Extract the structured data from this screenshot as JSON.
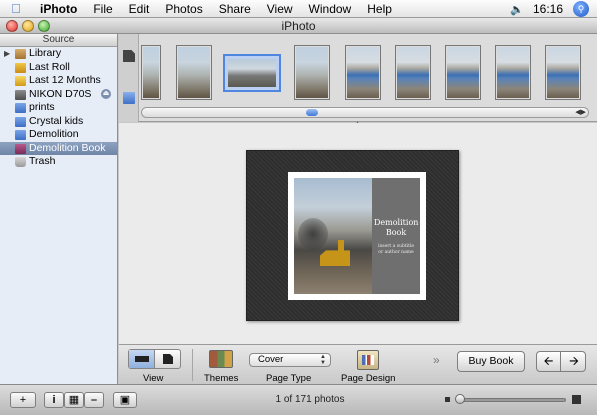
{
  "menubar": {
    "app": "iPhoto",
    "items": [
      "File",
      "Edit",
      "Photos",
      "Share",
      "View",
      "Window",
      "Help"
    ],
    "clock": "16:16"
  },
  "window": {
    "title": "iPhoto"
  },
  "sidebar": {
    "header": "Source",
    "items": [
      {
        "label": "Library",
        "icon": "library-icon"
      },
      {
        "label": "Last Roll",
        "icon": "film-roll-icon"
      },
      {
        "label": "Last 12 Months",
        "icon": "calendar-icon"
      },
      {
        "label": "NIKON D70S",
        "icon": "camera-icon"
      },
      {
        "label": "prints",
        "icon": "album-icon"
      },
      {
        "label": "Crystal kids",
        "icon": "album-icon"
      },
      {
        "label": "Demolition",
        "icon": "album-icon"
      },
      {
        "label": "Demolition Book",
        "icon": "book-icon",
        "selected": true
      },
      {
        "label": "Trash",
        "icon": "trash-icon"
      }
    ]
  },
  "book": {
    "title": "Demolition Book",
    "subtitle": "insert a subtitle or author name"
  },
  "booktools": {
    "view_label": "View",
    "themes_label": "Themes",
    "page_type_value": "Cover",
    "page_type_label": "Page Type",
    "page_design_label": "Page Design",
    "buy_book": "Buy Book",
    "more": "»"
  },
  "bottombar": {
    "status": "1 of 171 photos",
    "add": "+",
    "info": "i"
  },
  "colors": {
    "selection": "#7087a9",
    "accent": "#4f86e0",
    "sidebar_bg": "#e7edf6"
  }
}
